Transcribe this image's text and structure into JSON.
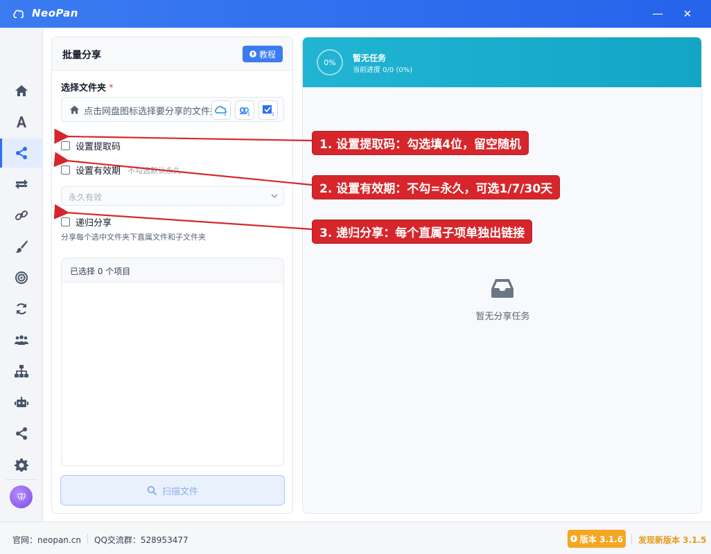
{
  "app": {
    "title": "NeoPan"
  },
  "window": {
    "minimize": "—",
    "close": "✕"
  },
  "sidebar": {
    "items": [
      {
        "icon": "home-icon"
      },
      {
        "icon": "text-icon"
      },
      {
        "icon": "share-icon",
        "active": true
      },
      {
        "icon": "transfer-icon"
      },
      {
        "icon": "link-icon"
      },
      {
        "icon": "brush-icon"
      },
      {
        "icon": "target-icon"
      },
      {
        "icon": "sync-icon"
      },
      {
        "icon": "users-icon"
      },
      {
        "icon": "sitemap-icon"
      },
      {
        "icon": "robot-icon"
      },
      {
        "icon": "share-alt-icon"
      },
      {
        "icon": "gear-icon"
      }
    ],
    "avatar_icon": "gem-icon"
  },
  "left_panel": {
    "title": "批量分享",
    "tutorial_label": "教程",
    "folder_label": "选择文件夹",
    "required_mark": "*",
    "folder_placeholder": "点击网盘图标选择要分享的文件夹",
    "pan_badges": [
      "1",
      "1",
      "1"
    ],
    "extract_code_label": "设置提取码",
    "expiry_label": "设置有效期",
    "expiry_hint": "不勾选默认永久",
    "expiry_select": "永久有效",
    "recursive_label": "递归分享",
    "recursive_desc": "分享每个选中文件夹下直属文件和子文件夹",
    "selected_header": "已选择 0 个项目",
    "scan_label": "扫描文件"
  },
  "right_panel": {
    "progress": "0%",
    "task_title": "暂无任务",
    "task_sub": "当前进度 0/0 (0%)",
    "empty_text": "暂无分享任务"
  },
  "annotations": [
    "1. 设置提取码：勾选填4位，留空随机",
    "2. 设置有效期：不勾=永久，可选1/7/30天",
    "3. 递归分享：每个直属子项单独出链接"
  ],
  "footer": {
    "site": "官网：neopan.cn",
    "qq": "QQ交流群：528953477",
    "version": "版本 3.1.6",
    "new_version": "发现新版本 3.1.5"
  },
  "colors": {
    "titlebar": "#2f6ef2",
    "accent": "#3b7bf0",
    "task_header": "#1aabc9",
    "annotation": "#d7262b",
    "version_badge": "#f5a623"
  }
}
